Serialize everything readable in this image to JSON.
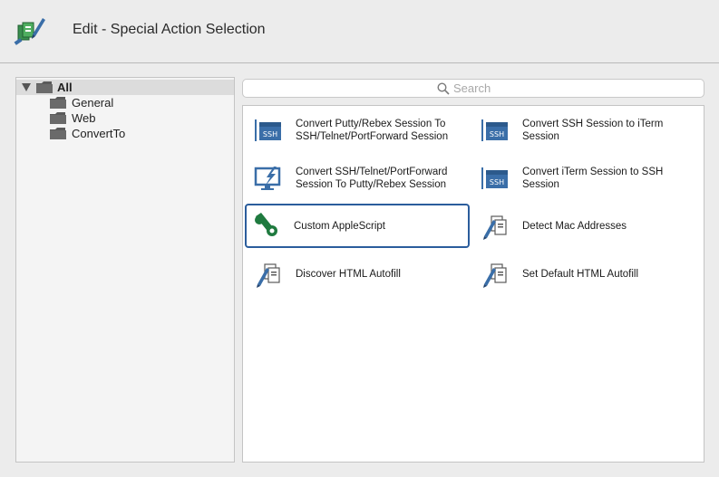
{
  "header": {
    "title": "Edit - Special Action Selection",
    "icon": "edit-pencil-documents-icon"
  },
  "sidebar": {
    "items": [
      {
        "label": "All",
        "icon": "folder-icon",
        "expanded": true,
        "selected": true
      },
      {
        "label": "General",
        "icon": "folder-icon"
      },
      {
        "label": "Web",
        "icon": "folder-icon"
      },
      {
        "label": "ConvertTo",
        "icon": "folder-icon"
      }
    ]
  },
  "search": {
    "placeholder": "Search",
    "value": ""
  },
  "actions": [
    {
      "label": "Convert Putty/Rebex Session To SSH/Telnet/PortForward Session",
      "icon": "ssh-terminal-icon"
    },
    {
      "label": "Convert SSH Session to iTerm Session",
      "icon": "ssh-terminal-icon"
    },
    {
      "label": "Convert SSH/Telnet/PortForward Session To Putty/Rebex Session",
      "icon": "monitor-lightning-icon"
    },
    {
      "label": "Convert iTerm Session to SSH Session",
      "icon": "ssh-terminal-icon"
    },
    {
      "label": "Custom AppleScript",
      "icon": "applescript-scroll-icon",
      "selected": true
    },
    {
      "label": "Detect Mac Addresses",
      "icon": "pencil-documents-icon"
    },
    {
      "label": "Discover HTML Autofill",
      "icon": "pencil-documents-icon"
    },
    {
      "label": "Set Default HTML Autofill",
      "icon": "pencil-documents-icon"
    }
  ],
  "colors": {
    "accent": "#2b5d9c",
    "icon_blue": "#3a6ea8",
    "icon_green": "#1f7a3f"
  }
}
